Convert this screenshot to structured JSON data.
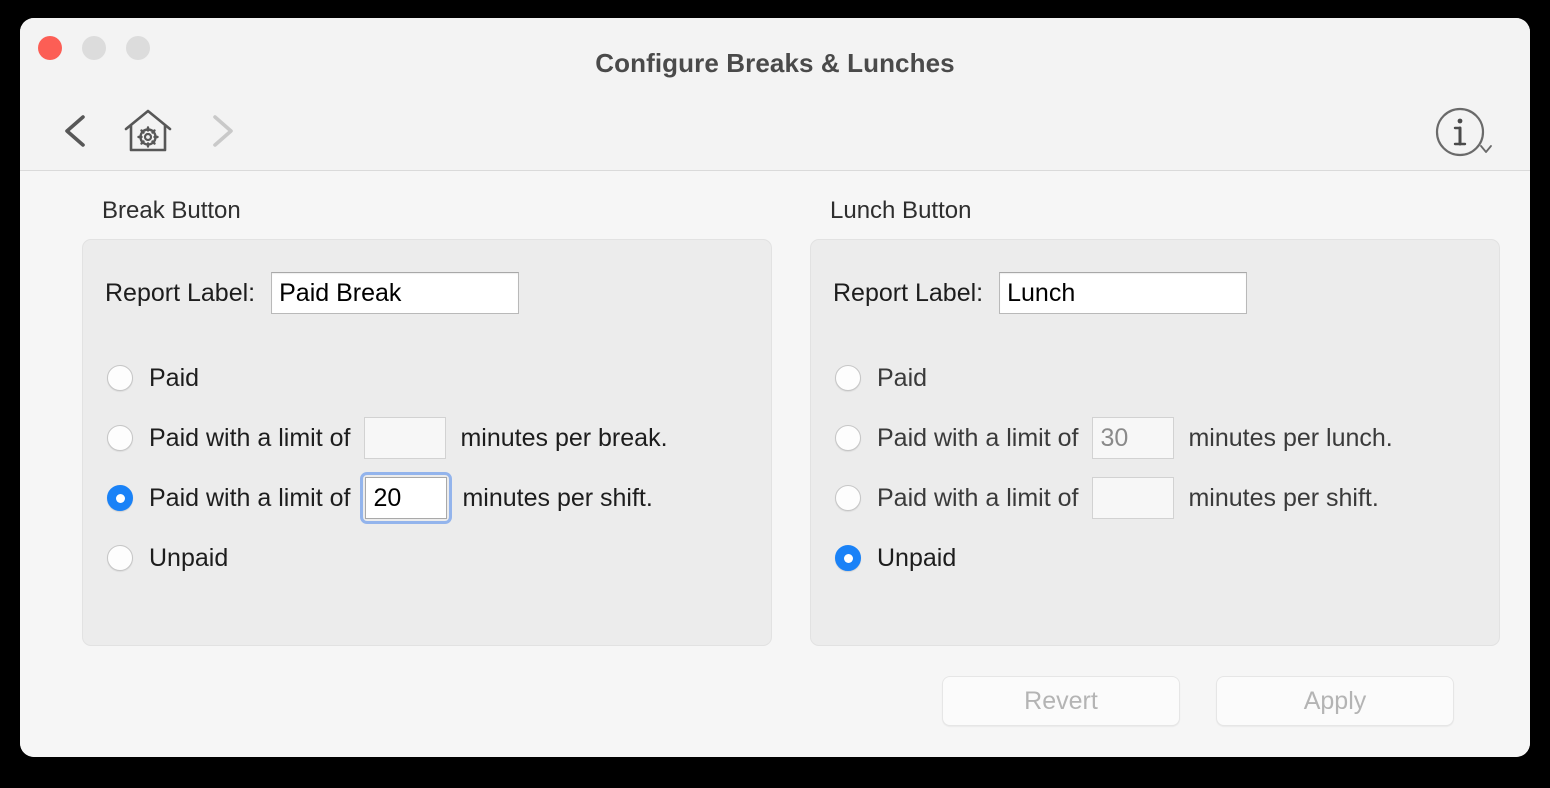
{
  "window": {
    "title": "Configure Breaks & Lunches",
    "traffic_lights": [
      "close",
      "minimize",
      "zoom"
    ]
  },
  "toolbar": {
    "back_icon": "chevron-left-icon",
    "home_icon": "house-gear-icon",
    "forward_icon": "chevron-right-icon",
    "info_icon": "info-circle-icon",
    "info_chevron_icon": "chevron-down-icon"
  },
  "break_section": {
    "title": "Break Button",
    "report_label": "Report Label:",
    "report_value": "Paid Break",
    "options": [
      {
        "label": "Paid",
        "selected": false,
        "has_field": false,
        "field_value": "",
        "trailing": ""
      },
      {
        "label": "Paid with a limit of",
        "selected": false,
        "has_field": true,
        "field_value": "",
        "trailing": "minutes per break."
      },
      {
        "label": "Paid with a limit of",
        "selected": true,
        "has_field": true,
        "field_value": "20",
        "trailing": "minutes per shift."
      },
      {
        "label": "Unpaid",
        "selected": false,
        "has_field": false,
        "field_value": "",
        "trailing": ""
      }
    ]
  },
  "lunch_section": {
    "title": "Lunch Button",
    "report_label": "Report Label:",
    "report_value": "Lunch",
    "options": [
      {
        "label": "Paid",
        "selected": false,
        "has_field": false,
        "field_value": "",
        "trailing": ""
      },
      {
        "label": "Paid with a limit of",
        "selected": false,
        "has_field": true,
        "field_value": "30",
        "trailing": "minutes per lunch."
      },
      {
        "label": "Paid with a limit of",
        "selected": false,
        "has_field": true,
        "field_value": "",
        "trailing": "minutes per shift."
      },
      {
        "label": "Unpaid",
        "selected": true,
        "has_field": false,
        "field_value": "",
        "trailing": ""
      }
    ]
  },
  "footer": {
    "revert_label": "Revert",
    "apply_label": "Apply"
  },
  "colors": {
    "accent_blue": "#1a82f7",
    "focus_ring": "#93b4ec",
    "close_red": "#fc5e55",
    "window_bg": "#f6f6f6",
    "group_bg": "#ececec",
    "disabled_text": "#b4b4b4"
  }
}
